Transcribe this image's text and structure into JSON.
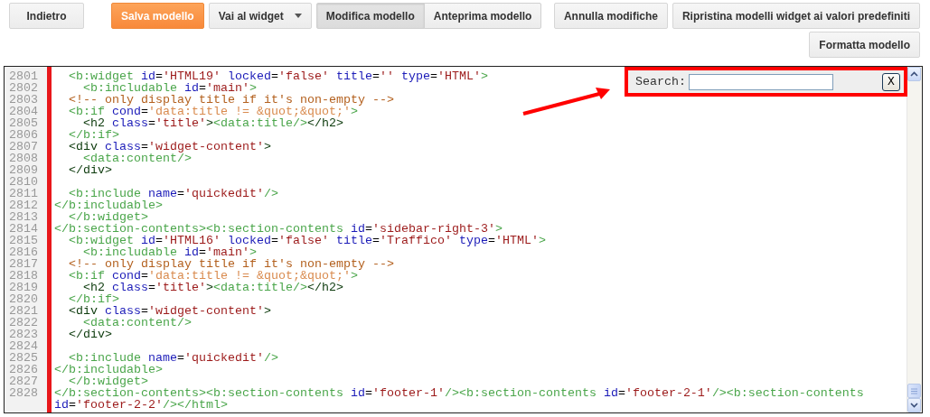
{
  "toolbar": {
    "left_buttons": [
      {
        "kind": "plain",
        "label": "Indietro"
      },
      {
        "kind": "primary",
        "label": "Salva modello"
      },
      {
        "kind": "dropdown",
        "label": "Vai al widget"
      }
    ],
    "mode_tabs": [
      {
        "label": "Modifica modello",
        "selected": true
      },
      {
        "label": "Anteprima modello",
        "selected": false
      }
    ],
    "right_buttons": [
      {
        "kind": "plain",
        "label": "Annulla modifiche"
      },
      {
        "kind": "plain",
        "label": "Ripristina modelli widget ai valori predefiniti"
      }
    ],
    "second_row_buttons": [
      {
        "kind": "plain",
        "label": "Formatta modello"
      }
    ]
  },
  "editor": {
    "search": {
      "label": "Search:",
      "close_button": "X"
    },
    "lines": [
      {
        "number": "2801",
        "tokens": [
          {
            "kind": "tag",
            "text": "  <b:widget"
          },
          {
            "kind": "attr",
            "text": " id"
          },
          {
            "kind": "plain",
            "text": "="
          },
          {
            "kind": "value",
            "text": "'HTML19'"
          },
          {
            "kind": "attr",
            "text": " locked"
          },
          {
            "kind": "plain",
            "text": "="
          },
          {
            "kind": "value",
            "text": "'false'"
          },
          {
            "kind": "attr",
            "text": " title"
          },
          {
            "kind": "plain",
            "text": "="
          },
          {
            "kind": "value",
            "text": "''"
          },
          {
            "kind": "attr",
            "text": " type"
          },
          {
            "kind": "plain",
            "text": "="
          },
          {
            "kind": "value",
            "text": "'HTML'"
          },
          {
            "kind": "tag",
            "text": ">"
          }
        ]
      },
      {
        "number": "2802",
        "tokens": [
          {
            "kind": "tag",
            "text": "    <b:includable"
          },
          {
            "kind": "attr",
            "text": " id"
          },
          {
            "kind": "plain",
            "text": "="
          },
          {
            "kind": "value",
            "text": "'main'"
          },
          {
            "kind": "tag",
            "text": ">"
          }
        ]
      },
      {
        "number": "2803",
        "tokens": [
          {
            "kind": "comment",
            "text": "  <!-- only display title if it's non-empty -->"
          }
        ]
      },
      {
        "number": "2804",
        "tokens": [
          {
            "kind": "tag",
            "text": "  <b:if"
          },
          {
            "kind": "attr",
            "text": " cond"
          },
          {
            "kind": "plain",
            "text": "="
          },
          {
            "kind": "string",
            "text": "'data:title != &quot;&quot;'"
          },
          {
            "kind": "tag",
            "text": ">"
          }
        ]
      },
      {
        "number": "2805",
        "tokens": [
          {
            "kind": "element",
            "text": "    <h2"
          },
          {
            "kind": "attr",
            "text": " class"
          },
          {
            "kind": "plain",
            "text": "="
          },
          {
            "kind": "value",
            "text": "'title'"
          },
          {
            "kind": "element",
            "text": ">"
          },
          {
            "kind": "tag",
            "text": "<data:title/>"
          },
          {
            "kind": "element",
            "text": "</h2>"
          }
        ]
      },
      {
        "number": "2806",
        "tokens": [
          {
            "kind": "tag",
            "text": "  </b:if>"
          }
        ]
      },
      {
        "number": "2807",
        "tokens": [
          {
            "kind": "element",
            "text": "  <div"
          },
          {
            "kind": "attr",
            "text": " class"
          },
          {
            "kind": "plain",
            "text": "="
          },
          {
            "kind": "value",
            "text": "'widget-content'"
          },
          {
            "kind": "element",
            "text": ">"
          }
        ]
      },
      {
        "number": "2808",
        "tokens": [
          {
            "kind": "tag",
            "text": "    <data:content/>"
          }
        ]
      },
      {
        "number": "2809",
        "tokens": [
          {
            "kind": "element",
            "text": "  </div>"
          }
        ]
      },
      {
        "number": "2810"
      },
      {
        "number": "2811",
        "tokens": [
          {
            "kind": "tag",
            "text": "  <b:include"
          },
          {
            "kind": "attr",
            "text": " name"
          },
          {
            "kind": "plain",
            "text": "="
          },
          {
            "kind": "value",
            "text": "'quickedit'"
          },
          {
            "kind": "tag",
            "text": "/>"
          }
        ]
      },
      {
        "number": "2812",
        "tokens": [
          {
            "kind": "tag",
            "text": "</b:includable>"
          }
        ]
      },
      {
        "number": "2813",
        "tokens": [
          {
            "kind": "tag",
            "text": "  </b:widget>"
          }
        ]
      },
      {
        "number": "2814",
        "tokens": [
          {
            "kind": "tag",
            "text": "</b:section-contents><b:section-contents"
          },
          {
            "kind": "attr",
            "text": " id"
          },
          {
            "kind": "plain",
            "text": "="
          },
          {
            "kind": "value",
            "text": "'sidebar-right-3'"
          },
          {
            "kind": "tag",
            "text": ">"
          }
        ]
      },
      {
        "number": "2815",
        "tokens": [
          {
            "kind": "tag",
            "text": "  <b:widget"
          },
          {
            "kind": "attr",
            "text": " id"
          },
          {
            "kind": "plain",
            "text": "="
          },
          {
            "kind": "value",
            "text": "'HTML16'"
          },
          {
            "kind": "attr",
            "text": " locked"
          },
          {
            "kind": "plain",
            "text": "="
          },
          {
            "kind": "value",
            "text": "'false'"
          },
          {
            "kind": "attr",
            "text": " title"
          },
          {
            "kind": "plain",
            "text": "="
          },
          {
            "kind": "value",
            "text": "'Traffico'"
          },
          {
            "kind": "attr",
            "text": " type"
          },
          {
            "kind": "plain",
            "text": "="
          },
          {
            "kind": "value",
            "text": "'HTML'"
          },
          {
            "kind": "tag",
            "text": ">"
          }
        ]
      },
      {
        "number": "2816",
        "tokens": [
          {
            "kind": "tag",
            "text": "    <b:includable"
          },
          {
            "kind": "attr",
            "text": " id"
          },
          {
            "kind": "plain",
            "text": "="
          },
          {
            "kind": "value",
            "text": "'main'"
          },
          {
            "kind": "tag",
            "text": ">"
          }
        ]
      },
      {
        "number": "2817",
        "tokens": [
          {
            "kind": "comment",
            "text": "  <!-- only display title if it's non-empty -->"
          }
        ]
      },
      {
        "number": "2818",
        "tokens": [
          {
            "kind": "tag",
            "text": "  <b:if"
          },
          {
            "kind": "attr",
            "text": " cond"
          },
          {
            "kind": "plain",
            "text": "="
          },
          {
            "kind": "string",
            "text": "'data:title != &quot;&quot;'"
          },
          {
            "kind": "tag",
            "text": ">"
          }
        ]
      },
      {
        "number": "2819",
        "tokens": [
          {
            "kind": "element",
            "text": "    <h2"
          },
          {
            "kind": "attr",
            "text": " class"
          },
          {
            "kind": "plain",
            "text": "="
          },
          {
            "kind": "value",
            "text": "'title'"
          },
          {
            "kind": "element",
            "text": ">"
          },
          {
            "kind": "tag",
            "text": "<data:title/>"
          },
          {
            "kind": "element",
            "text": "</h2>"
          }
        ]
      },
      {
        "number": "2820",
        "tokens": [
          {
            "kind": "tag",
            "text": "  </b:if>"
          }
        ]
      },
      {
        "number": "2821",
        "tokens": [
          {
            "kind": "element",
            "text": "  <div"
          },
          {
            "kind": "attr",
            "text": " class"
          },
          {
            "kind": "plain",
            "text": "="
          },
          {
            "kind": "value",
            "text": "'widget-content'"
          },
          {
            "kind": "element",
            "text": ">"
          }
        ]
      },
      {
        "number": "2822",
        "tokens": [
          {
            "kind": "tag",
            "text": "    <data:content/>"
          }
        ]
      },
      {
        "number": "2823",
        "tokens": [
          {
            "kind": "element",
            "text": "  </div>"
          }
        ]
      },
      {
        "number": "2824"
      },
      {
        "number": "2825",
        "tokens": [
          {
            "kind": "tag",
            "text": "  <b:include"
          },
          {
            "kind": "attr",
            "text": " name"
          },
          {
            "kind": "plain",
            "text": "="
          },
          {
            "kind": "value",
            "text": "'quickedit'"
          },
          {
            "kind": "tag",
            "text": "/>"
          }
        ]
      },
      {
        "number": "2826",
        "tokens": [
          {
            "kind": "tag",
            "text": "</b:includable>"
          }
        ]
      },
      {
        "number": "2827",
        "tokens": [
          {
            "kind": "tag",
            "text": "  </b:widget>"
          }
        ]
      },
      {
        "number": "2828",
        "tokens": [
          {
            "kind": "tag",
            "text": "</b:section-contents><b:section-contents"
          },
          {
            "kind": "attr",
            "text": " id"
          },
          {
            "kind": "plain",
            "text": "="
          },
          {
            "kind": "value",
            "text": "'footer-1'"
          },
          {
            "kind": "tag",
            "text": "/><b:section-contents"
          },
          {
            "kind": "attr",
            "text": " id"
          },
          {
            "kind": "plain",
            "text": "="
          },
          {
            "kind": "value",
            "text": "'footer-2-1'"
          },
          {
            "kind": "tag",
            "text": "/><b:section-contents"
          },
          {
            "kind": "attr",
            "text": " id"
          },
          {
            "kind": "plain",
            "text": "="
          },
          {
            "kind": "value",
            "text": "'footer-2-2'"
          },
          {
            "kind": "tag",
            "text": "/></html>"
          }
        ]
      }
    ]
  }
}
